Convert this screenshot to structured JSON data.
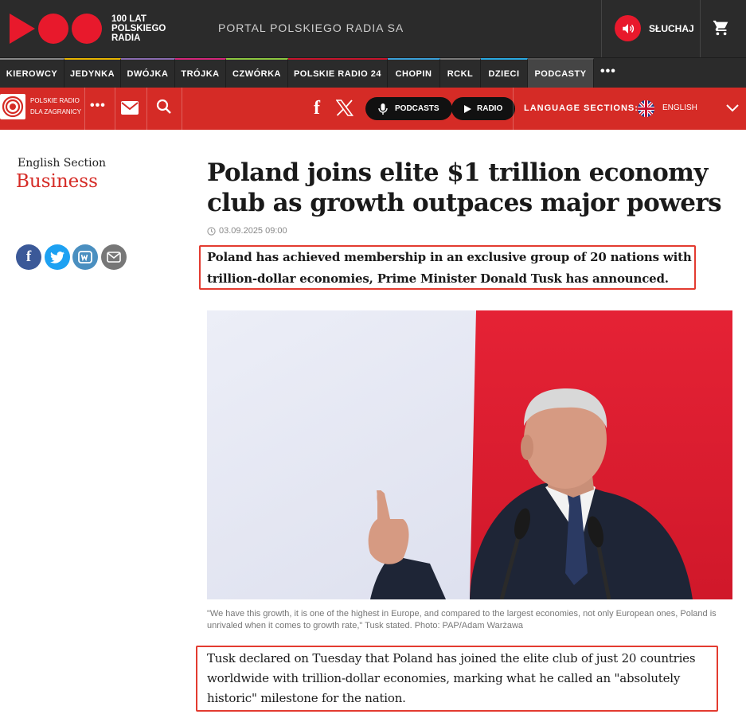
{
  "topbar": {
    "logo_text": "100 LAT POLSKIEGO RADIA",
    "portal_label": "PORTAL POLSKIEGO RADIA SA",
    "listen_label": "SŁUCHAJ"
  },
  "channels": [
    {
      "label": "KIEROWCY",
      "accent": "#888888"
    },
    {
      "label": "JEDYNKA",
      "accent": "#e6b400"
    },
    {
      "label": "DWÓJKA",
      "accent": "#8a6bb0"
    },
    {
      "label": "TRÓJKA",
      "accent": "#d4267a"
    },
    {
      "label": "CZWÓRKA",
      "accent": "#8cc63f"
    },
    {
      "label": "POLSKIE RADIO 24",
      "accent": "#c8142c"
    },
    {
      "label": "CHOPIN",
      "accent": "#3aa0d8"
    },
    {
      "label": "RCKL",
      "accent": "#7a7a7a"
    },
    {
      "label": "DZIECI",
      "accent": "#29a8e0"
    },
    {
      "label": "PODCASTY",
      "accent": "#555555"
    }
  ],
  "redbar": {
    "prdz_text": "POLSKIE RADIO DLA ZAGRANICY",
    "podcasts_label": "PODCASTS",
    "radio_label": "RADIO",
    "language_label": "LANGUAGE SECTIONS:",
    "language_value": "ENGLISH"
  },
  "sidebar": {
    "section_label": "English Section",
    "section_name": "Business"
  },
  "article": {
    "headline": "Poland joins elite $1 trillion economy club as growth outpaces major powers",
    "date": "03.09.2025 09:00",
    "lead": "Poland has achieved membership in an exclusive group of 20 nations with trillion-dollar economies, Prime Minister Donald Tusk has announced.",
    "caption": "\"We have this growth, it is one of the highest in Europe, and compared to the largest economies, not only European ones, Poland is unrivaled when it comes to growth rate,\" Tusk stated.    Photo: PAP/Adam Warżawa",
    "body_paragraph": "Tusk declared on Tuesday that Poland has joined the elite club of just 20 countries worldwide with trillion-dollar economies, marking what he called an \"absolutely historic\" milestone for the nation."
  },
  "colors": {
    "brand_red": "#e8192c",
    "bar_red": "#d52b26",
    "dark": "#2b2b2b",
    "highlight": "#e33b30"
  }
}
